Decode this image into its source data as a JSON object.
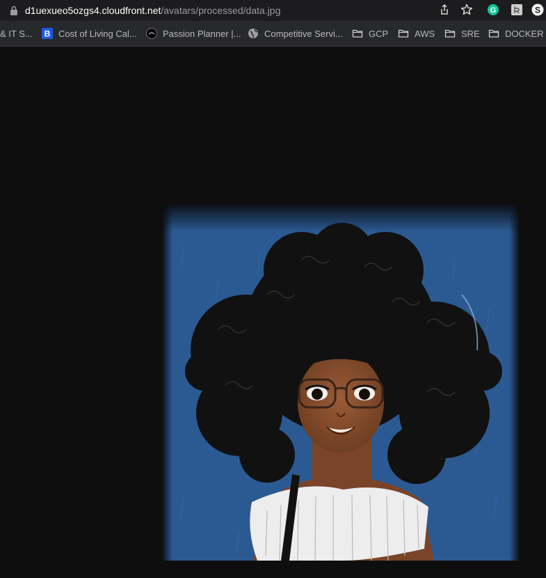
{
  "browser": {
    "url_host": "d1uexueo5ozgs4.cloudfront.net",
    "url_path": "/avatars/processed/data.jpg",
    "icons": [
      "lock-icon",
      "share-icon",
      "bookmark-star-icon",
      "grammarly-extension-icon",
      "extension-icon",
      "extension-s-icon"
    ]
  },
  "bookmarks": [
    {
      "label": "& IT S...",
      "icon": "none"
    },
    {
      "label": "Cost of Living Cal...",
      "icon": "b-icon"
    },
    {
      "label": "Passion Planner |...",
      "icon": "passion-planner-icon"
    },
    {
      "label": "Competitive Servi...",
      "icon": "globe-icon"
    },
    {
      "label": "GCP",
      "icon": "folder-icon"
    },
    {
      "label": "AWS",
      "icon": "folder-icon"
    },
    {
      "label": "SRE",
      "icon": "folder-icon"
    },
    {
      "label": "DOCKER",
      "icon": "folder-icon"
    }
  ],
  "image": {
    "subject": "avatar-illustration",
    "colors": {
      "page_bg": "#0e0e0e",
      "sky": "#2b5a93",
      "skin": "#8a5232",
      "hair": "#111111",
      "top": "#eeeeee"
    }
  }
}
